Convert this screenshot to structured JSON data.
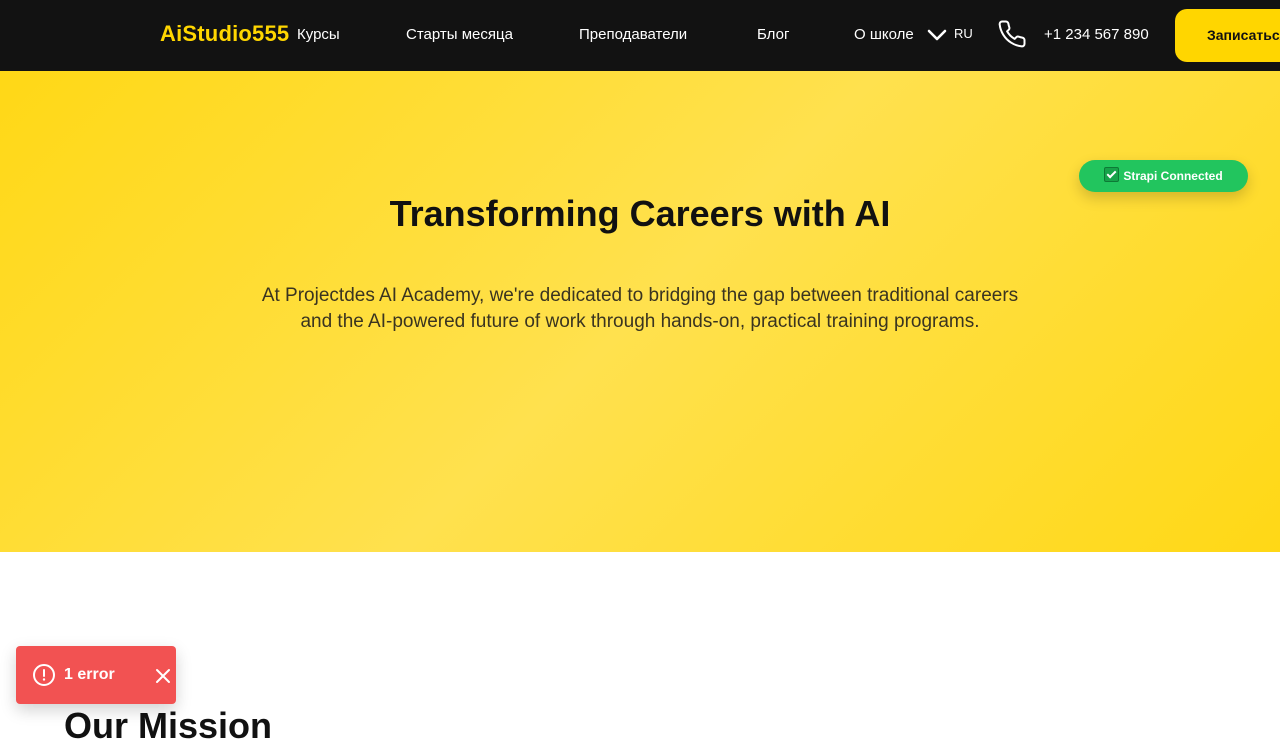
{
  "header": {
    "logo": "AiStudio555",
    "nav": [
      "Курсы",
      "Старты месяца",
      "Преподаватели",
      "Блог",
      "О школе"
    ],
    "language": "RU",
    "phone": "+1 234 567 890",
    "cta_label": "Записаться"
  },
  "hero": {
    "title": "Transforming Careers with AI",
    "text": "At Projectdes AI Academy, we're dedicated to bridging the gap between traditional careers and the AI-powered future of work through hands-on, practical training programs.",
    "badge": "Strapi Connected"
  },
  "section": {
    "heading": "Our Mission"
  },
  "toast": {
    "label": "1 error"
  },
  "colors": {
    "accent": "#FFD600",
    "header_bg": "#121212",
    "badge": "#22C55E",
    "error": "#F25252"
  },
  "icons": {
    "chevron": "chevron-down-icon",
    "phone": "phone-icon",
    "badge": "check-icon",
    "error": "alert-circle-icon",
    "close": "close-icon"
  }
}
